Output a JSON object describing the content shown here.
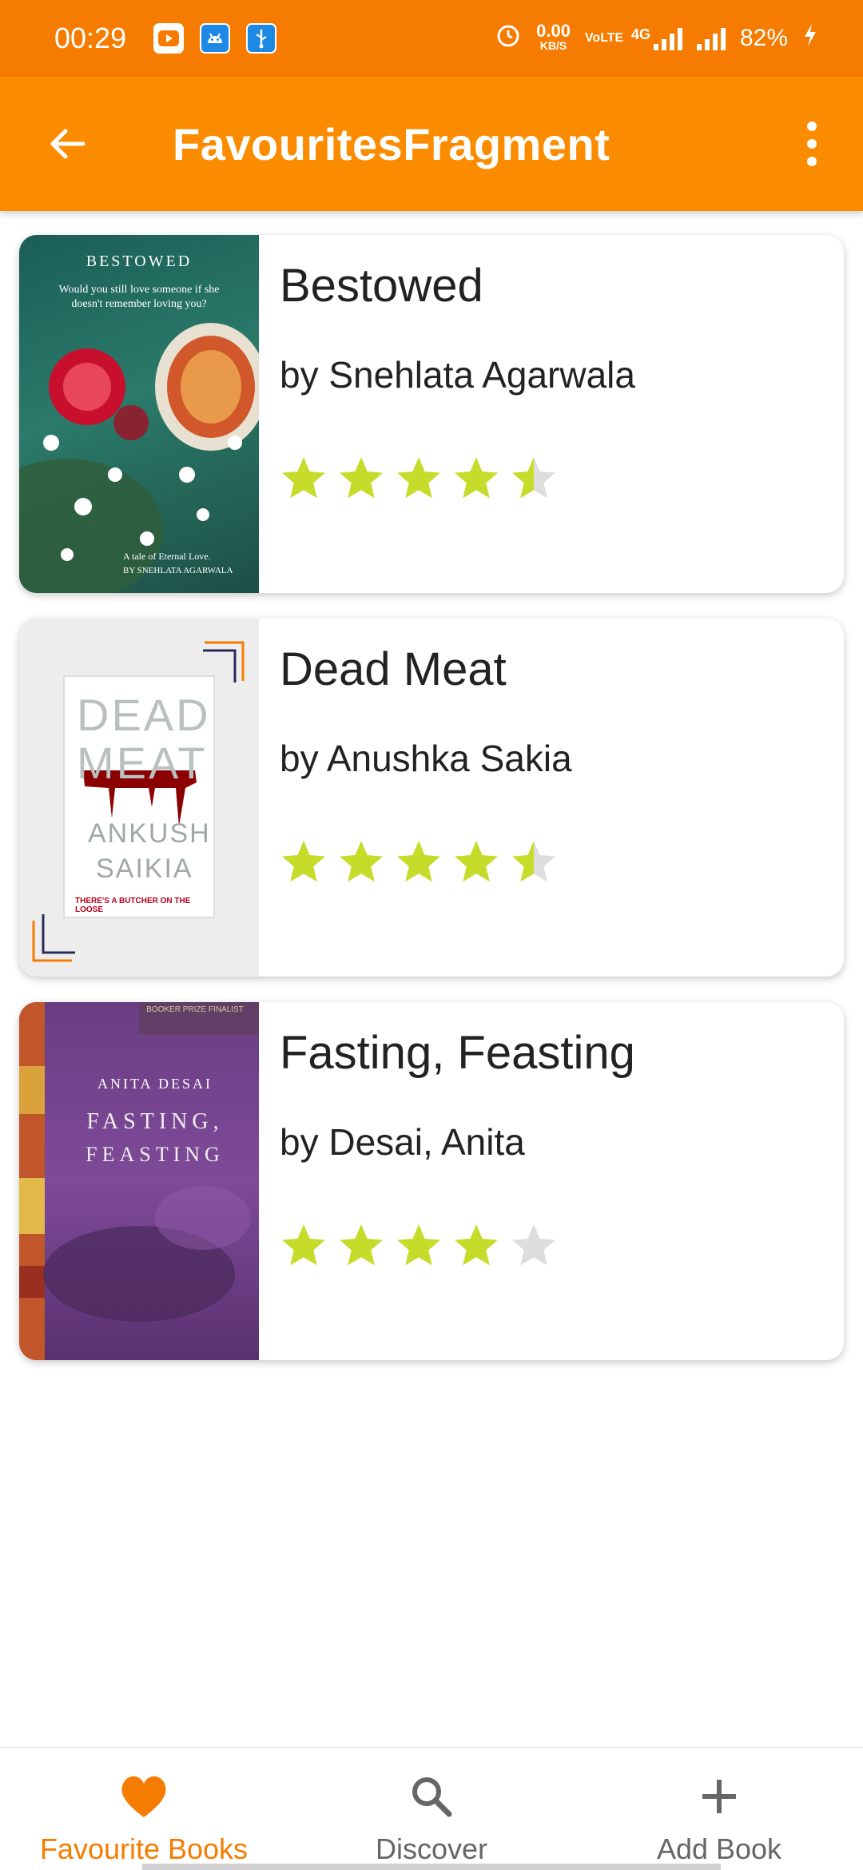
{
  "status_bar": {
    "time": "00:29",
    "net_speed": "0.00",
    "net_unit": "KB/S",
    "volte": "VoLTE",
    "network": "4G",
    "battery": "82%"
  },
  "app_bar": {
    "title": "FavouritesFragment"
  },
  "books": [
    {
      "title": "Bestowed",
      "author": "by  Snehlata Agarwala",
      "rating": 4.5,
      "cover_text": {
        "top": "BESTOWED",
        "tagline": "Would you still love someone if she doesn't remember loving you?",
        "bottom": "A tale of Eternal Love.",
        "byline": "BY SNEHLATA AGARWALA"
      }
    },
    {
      "title": "Dead Meat",
      "author": "by  Anushka Sakia",
      "rating": 4.5,
      "cover_text": {
        "line1": "DEAD",
        "line2": "MEAT",
        "line3": "ANKUSH",
        "line4": "SAIKIA",
        "tagline": "THERE'S A BUTCHER ON THE LOOSE"
      }
    },
    {
      "title": "Fasting, Feasting",
      "author": "by  Desai,  Anita",
      "rating": 4.0,
      "cover_text": {
        "badge": "BOOKER PRIZE FINALIST",
        "author": "ANITA DESAI",
        "line1": "FASTING,",
        "line2": "FEASTING"
      }
    }
  ],
  "bottom_nav": {
    "items": [
      {
        "label": "Favourite Books",
        "icon": "heart-icon",
        "active": true
      },
      {
        "label": "Discover",
        "icon": "search-icon",
        "active": false
      },
      {
        "label": "Add Book",
        "icon": "plus-icon",
        "active": false
      }
    ]
  },
  "colors": {
    "status_bar": "#f57c00",
    "app_bar": "#fb8c00",
    "star_filled": "#c6dc2b",
    "star_empty": "#dddddd",
    "accent": "#f57c00"
  }
}
